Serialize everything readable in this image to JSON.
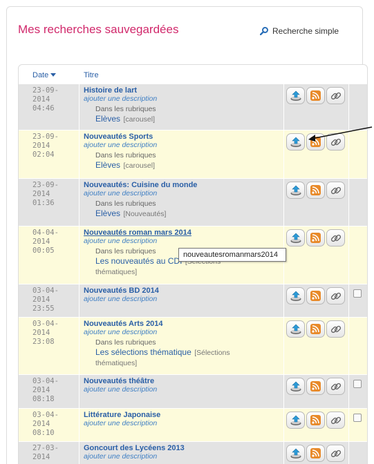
{
  "page": {
    "title": "Mes recherches sauvegardées"
  },
  "simple_search": {
    "label": "Recherche simple",
    "icon": "magnifier-icon"
  },
  "table": {
    "col_date": "Date",
    "col_title": "Titre",
    "rows": [
      {
        "date": [
          "23-09-",
          "2014",
          "04:46"
        ],
        "name": "Histoire de lart",
        "desc": "ajouter une description",
        "dans": "Dans les rubriques",
        "rubrique": "Elèves",
        "tag": "[carousel]",
        "checkbox": false
      },
      {
        "date": [
          "23-09-",
          "2014",
          "02:04"
        ],
        "name": "Nouveautés Sports",
        "desc": "ajouter une description",
        "dans": "Dans les rubriques",
        "rubrique": "Elèves",
        "tag": "[carousel]",
        "checkbox": false
      },
      {
        "date": [
          "23-09-",
          "2014",
          "01:36"
        ],
        "name": "Nouveautés: Cuisine du monde",
        "desc": "ajouter une description",
        "dans": "Dans les rubriques",
        "rubrique": "Elèves",
        "tag": "[Nouveautés]",
        "checkbox": false
      },
      {
        "date": [
          "04-04-",
          "2014",
          "00:05"
        ],
        "name": "Nouveautés roman mars 2014",
        "desc": "ajouter une description",
        "dans": "Dans les rubriques",
        "rubrique": "Les nouveautés au CDI",
        "tag": "[Sélections",
        "tag2": "thématiques]",
        "checkbox": false
      },
      {
        "date": [
          "03-04-",
          "2014",
          "23:55"
        ],
        "name": "Nouveautés BD 2014",
        "desc": "ajouter une description",
        "checkbox": true
      },
      {
        "date": [
          "03-04-",
          "2014",
          "23:08"
        ],
        "name": "Nouveautés Arts 2014",
        "desc": "ajouter une description",
        "dans": "Dans les rubriques",
        "rubrique": "Les sélections thématique",
        "tag": "[Sélections",
        "tag2": "thématiques]",
        "checkbox": false
      },
      {
        "date": [
          "03-04-",
          "2014",
          "08:18"
        ],
        "name": "Nouveautés théâtre",
        "desc": "ajouter une description",
        "checkbox": true
      },
      {
        "date": [
          "03-04-",
          "2014",
          "08:10"
        ],
        "name": "Littérature Japonaise",
        "desc": "ajouter une description",
        "checkbox": true
      },
      {
        "date": [
          "27-03-",
          "2014",
          ""
        ],
        "name": "Goncourt des Lycéens 2013",
        "desc": "ajouter une description",
        "checkbox": false
      }
    ]
  },
  "actions": {
    "icons": [
      "upload-icon",
      "rss-icon",
      "link-icon"
    ]
  },
  "tooltip": {
    "text": "nouveautesromanmars2014"
  },
  "colors": {
    "title": "#d1286b",
    "link": "#2a5fa6",
    "row_gray": "#e3e3e3",
    "row_yellow": "#fdfbdb"
  }
}
